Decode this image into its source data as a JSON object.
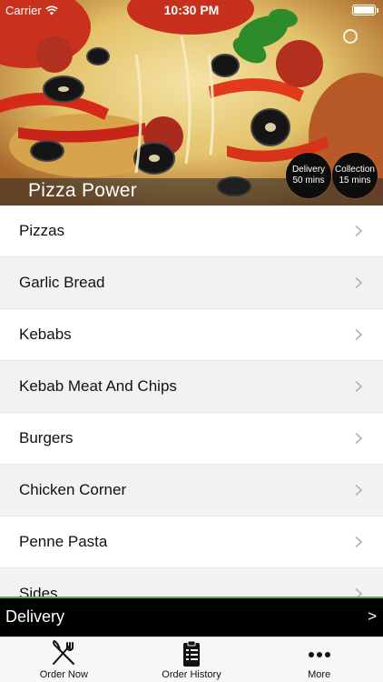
{
  "status_bar": {
    "carrier": "Carrier",
    "time": "10:30 PM"
  },
  "header": {
    "restaurant_name": "Pizza Power",
    "badges": [
      {
        "title": "Delivery",
        "subtitle": "50 mins"
      },
      {
        "title": "Collection",
        "subtitle": "15 mins"
      }
    ]
  },
  "menu": {
    "items": [
      {
        "label": "Pizzas"
      },
      {
        "label": "Garlic Bread"
      },
      {
        "label": "Kebabs"
      },
      {
        "label": "Kebab Meat And Chips"
      },
      {
        "label": "Burgers"
      },
      {
        "label": "Chicken Corner"
      },
      {
        "label": "Penne Pasta"
      },
      {
        "label": "Sides"
      }
    ]
  },
  "delivery_bar": {
    "label": "Delivery",
    "arrow": ">"
  },
  "tab_bar": {
    "tabs": [
      {
        "label": "Order Now",
        "icon": "fork-knife-icon"
      },
      {
        "label": "Order History",
        "icon": "clipboard-icon"
      },
      {
        "label": "More",
        "icon": "more-dots-icon"
      }
    ]
  },
  "colors": {
    "delivery_bar_bg": "#000000",
    "delivery_bar_accent": "#5ca850",
    "list_alt_row": "#f1f2f4",
    "badge_bg": "#0d0d0d"
  }
}
